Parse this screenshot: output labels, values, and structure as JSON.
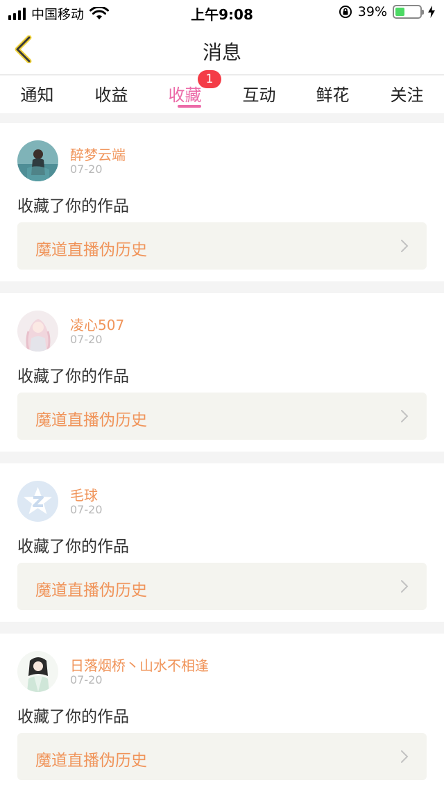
{
  "status_bar": {
    "carrier": "中国移动",
    "time": "上午9:08",
    "battery_percent": "39%",
    "battery_level": 0.39,
    "icons": [
      "signal-icon",
      "wifi-icon",
      "rotation-lock-icon",
      "battery-icon",
      "charging-bolt-icon"
    ]
  },
  "nav": {
    "title": "消息",
    "back_icon": "chevron-left-icon"
  },
  "tabs": [
    {
      "label": "通知",
      "active": false
    },
    {
      "label": "收益",
      "active": false
    },
    {
      "label": "收藏",
      "active": true,
      "badge": "1"
    },
    {
      "label": "互动",
      "active": false
    },
    {
      "label": "鲜花",
      "active": false
    },
    {
      "label": "关注",
      "active": false
    }
  ],
  "colors": {
    "accent_pink": "#ec6aa8",
    "badge_red": "#f43c47",
    "name_orange": "#f0945a",
    "link_bg": "#f4f4ef"
  },
  "messages": [
    {
      "username": "醉梦云端",
      "date": "07-20",
      "action": "收藏了你的作品",
      "work_title": "魔道直播伪历史"
    },
    {
      "username": "凌心507",
      "date": "07-20",
      "action": "收藏了你的作品",
      "work_title": "魔道直播伪历史"
    },
    {
      "username": "毛球",
      "date": "07-20",
      "action": "收藏了你的作品",
      "work_title": "魔道直播伪历史"
    },
    {
      "username": "日落烟桥丶山水不相逢",
      "date": "07-20",
      "action": "收藏了你的作品",
      "work_title": "魔道直播伪历史"
    }
  ]
}
